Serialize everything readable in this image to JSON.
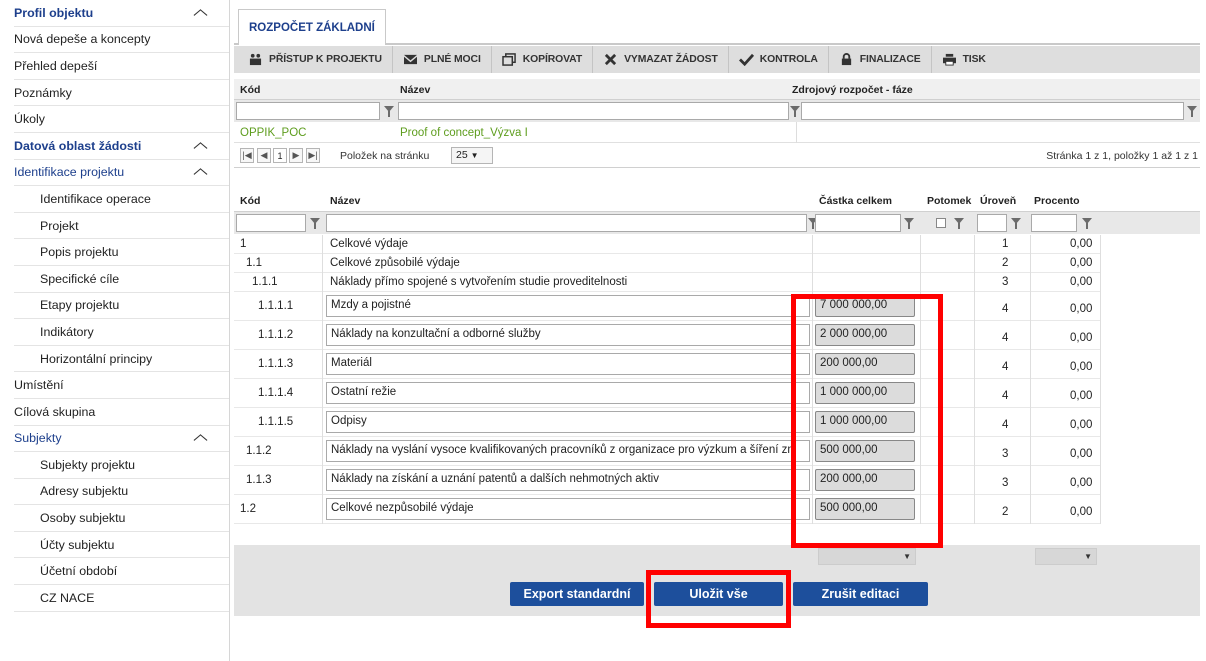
{
  "sidebar": {
    "items": [
      {
        "label": "Profil objektu",
        "type": "section"
      },
      {
        "label": "Nová depeše a koncepty",
        "type": "item"
      },
      {
        "label": "Přehled depeší",
        "type": "item"
      },
      {
        "label": "Poznámky",
        "type": "item"
      },
      {
        "label": "Úkoly",
        "type": "item"
      },
      {
        "label": "Datová oblast žádosti",
        "type": "section"
      },
      {
        "label": "Identifikace projektu",
        "type": "subsection"
      },
      {
        "label": "Identifikace operace",
        "type": "sub"
      },
      {
        "label": "Projekt",
        "type": "sub"
      },
      {
        "label": "Popis projektu",
        "type": "sub"
      },
      {
        "label": "Specifické cíle",
        "type": "sub"
      },
      {
        "label": "Etapy projektu",
        "type": "sub"
      },
      {
        "label": "Indikátory",
        "type": "sub"
      },
      {
        "label": "Horizontální principy",
        "type": "sub"
      },
      {
        "label": "Umístění",
        "type": "item"
      },
      {
        "label": "Cílová skupina",
        "type": "item"
      },
      {
        "label": "Subjekty",
        "type": "subsection"
      },
      {
        "label": "Subjekty projektu",
        "type": "sub"
      },
      {
        "label": "Adresy subjektu",
        "type": "sub"
      },
      {
        "label": "Osoby subjektu",
        "type": "sub"
      },
      {
        "label": "Účty subjektu",
        "type": "sub"
      },
      {
        "label": "Účetní období",
        "type": "sub"
      },
      {
        "label": "CZ NACE",
        "type": "sub"
      }
    ]
  },
  "tab": {
    "label": "ROZPOČET ZÁKLADNÍ"
  },
  "toolbar": {
    "buttons": [
      {
        "label": "PŘÍSTUP K PROJEKTU",
        "icon": "people-icon"
      },
      {
        "label": "PLNÉ MOCI",
        "icon": "envelope-icon"
      },
      {
        "label": "KOPÍROVAT",
        "icon": "copy-icon"
      },
      {
        "label": "VYMAZAT ŽÁDOST",
        "icon": "cross-icon"
      },
      {
        "label": "KONTROLA",
        "icon": "check-icon"
      },
      {
        "label": "FINALIZACE",
        "icon": "lock-icon"
      },
      {
        "label": "TISK",
        "icon": "printer-icon"
      }
    ]
  },
  "upper_grid": {
    "headers": {
      "kod": "Kód",
      "nazev": "Název",
      "zdroj": "Zdrojový rozpočet - fáze"
    },
    "row": {
      "kod": "OPPIK_POC",
      "nazev": "Proof of concept_Výzva I",
      "zdroj": ""
    },
    "pager": {
      "current_page": "1",
      "per_page_label": "Položek na stránku",
      "per_page": "25",
      "summary": "Stránka 1 z 1, položky 1 až 1 z 1"
    }
  },
  "lower_grid": {
    "headers": {
      "kod": "Kód",
      "nazev": "Název",
      "castka": "Částka celkem",
      "potomek": "Potomek",
      "uroven": "Úroveň",
      "procento": "Procento"
    },
    "rows": [
      {
        "kod": "1",
        "nazev": "Celkové výdaje",
        "castka": "",
        "uroven": "1",
        "procento": "0,00"
      },
      {
        "kod": "1.1",
        "nazev": "Celkové způsobilé výdaje",
        "castka": "",
        "uroven": "2",
        "procento": "0,00"
      },
      {
        "kod": "1.1.1",
        "nazev": "Náklady přímo spojené s vytvořením studie proveditelnosti",
        "castka": "",
        "uroven": "3",
        "procento": "0,00"
      },
      {
        "kod": "1.1.1.1",
        "nazev": "Mzdy a pojistné",
        "castka": "7 000 000,00",
        "uroven": "4",
        "procento": "0,00"
      },
      {
        "kod": "1.1.1.2",
        "nazev": "Náklady na konzultační a odborné služby",
        "castka": "2 000 000,00",
        "uroven": "4",
        "procento": "0,00"
      },
      {
        "kod": "1.1.1.3",
        "nazev": "Materiál",
        "castka": "200 000,00",
        "uroven": "4",
        "procento": "0,00"
      },
      {
        "kod": "1.1.1.4",
        "nazev": "Ostatní režie",
        "castka": "1 000 000,00",
        "uroven": "4",
        "procento": "0,00"
      },
      {
        "kod": "1.1.1.5",
        "nazev": "Odpisy",
        "castka": "1 000 000,00",
        "uroven": "4",
        "procento": "0,00"
      },
      {
        "kod": "1.1.2",
        "nazev": "Náklady na vyslání vysoce kvalifikovaných pracovníků z organizace pro výzkum a šíření znalostí",
        "castka": "500 000,00",
        "uroven": "3",
        "procento": "0,00"
      },
      {
        "kod": "1.1.3",
        "nazev": "Náklady na získání a uznání patentů a dalších nehmotných aktiv",
        "castka": "200 000,00",
        "uroven": "3",
        "procento": "0,00"
      },
      {
        "kod": "1.2",
        "nazev": "Celkové nezpůsobilé výdaje",
        "castka": "500 000,00",
        "uroven": "2",
        "procento": "0,00"
      }
    ]
  },
  "buttons": {
    "export": "Export standardní",
    "save": "Uložit vše",
    "cancel": "Zrušit editaci"
  }
}
